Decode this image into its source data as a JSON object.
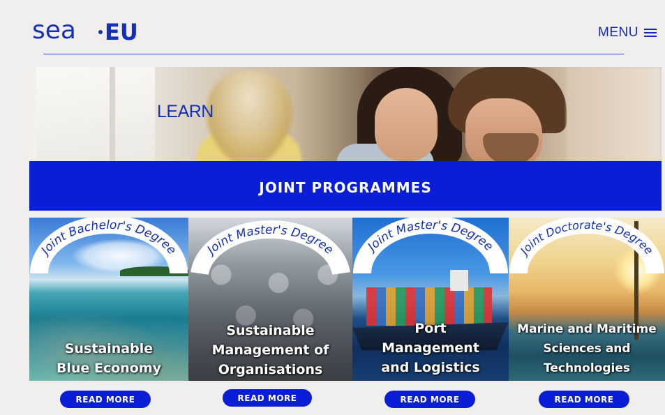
{
  "header": {
    "logo_text_left": "sea",
    "logo_text_right": "EU",
    "menu_label": "MENU",
    "menu_icon": "hamburger-icon"
  },
  "hero": {
    "title": "LEARN"
  },
  "banner": {
    "title": "JOINT PROGRAMMES"
  },
  "programmes": [
    {
      "degree": "Joint Bachelor's Degree",
      "title": "Sustainable\nBlue Economy",
      "button": "READ MORE"
    },
    {
      "degree": "Joint Master's Degree",
      "title": "Sustainable\nManagement of\nOrganisations",
      "button": "READ MORE"
    },
    {
      "degree": "Joint Master's Degree",
      "title": "Port\nManagement\nand Logistics",
      "button": "READ MORE"
    },
    {
      "degree": "Joint Doctorate's Degree",
      "title": "Marine and Maritime\nSciences and\nTechnologies",
      "button": "READ MORE"
    }
  ],
  "colors": {
    "brand_blue": "#0a1ed6",
    "text_blue": "#1530b8",
    "background": "#f1eeee"
  }
}
